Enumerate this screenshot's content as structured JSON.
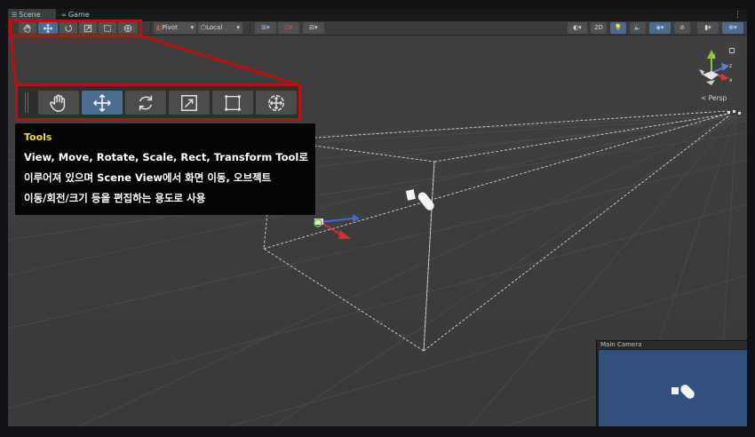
{
  "tabs": [
    {
      "label": "Scene",
      "icon": "scene-tab-icon"
    },
    {
      "label": "Game",
      "icon": "game-tab-icon"
    }
  ],
  "toolbar": {
    "pivot_label": "Pivot",
    "local_label": "Local",
    "mode_2d_label": "2D"
  },
  "tools": [
    {
      "name": "View",
      "icon": "hand-icon"
    },
    {
      "name": "Move",
      "icon": "move-arrows-icon",
      "active": true
    },
    {
      "name": "Rotate",
      "icon": "rotate-icon"
    },
    {
      "name": "Scale",
      "icon": "scale-icon"
    },
    {
      "name": "Rect",
      "icon": "rect-tool-icon"
    },
    {
      "name": "Transform",
      "icon": "transform-icon"
    }
  ],
  "tooltip": {
    "title": "Tools",
    "lines": [
      "View, Move, Rotate, Scale, Rect, Transform Tool로",
      "이루어져 있으며 Scene View에서 화면 이동, 오브젝트",
      "이동/회전/크기 등을 편집하는 용도로 사용"
    ]
  },
  "gizmo": {
    "projection_label": "< Persp",
    "axes": [
      "y",
      "z",
      "x"
    ]
  },
  "camera_preview": {
    "title": "Main Camera"
  },
  "colors": {
    "highlight": "#c10f0f",
    "active_tool": "#4f6c91",
    "tooltip_title": "#f0d84a",
    "camera_bg": "#30507e"
  }
}
